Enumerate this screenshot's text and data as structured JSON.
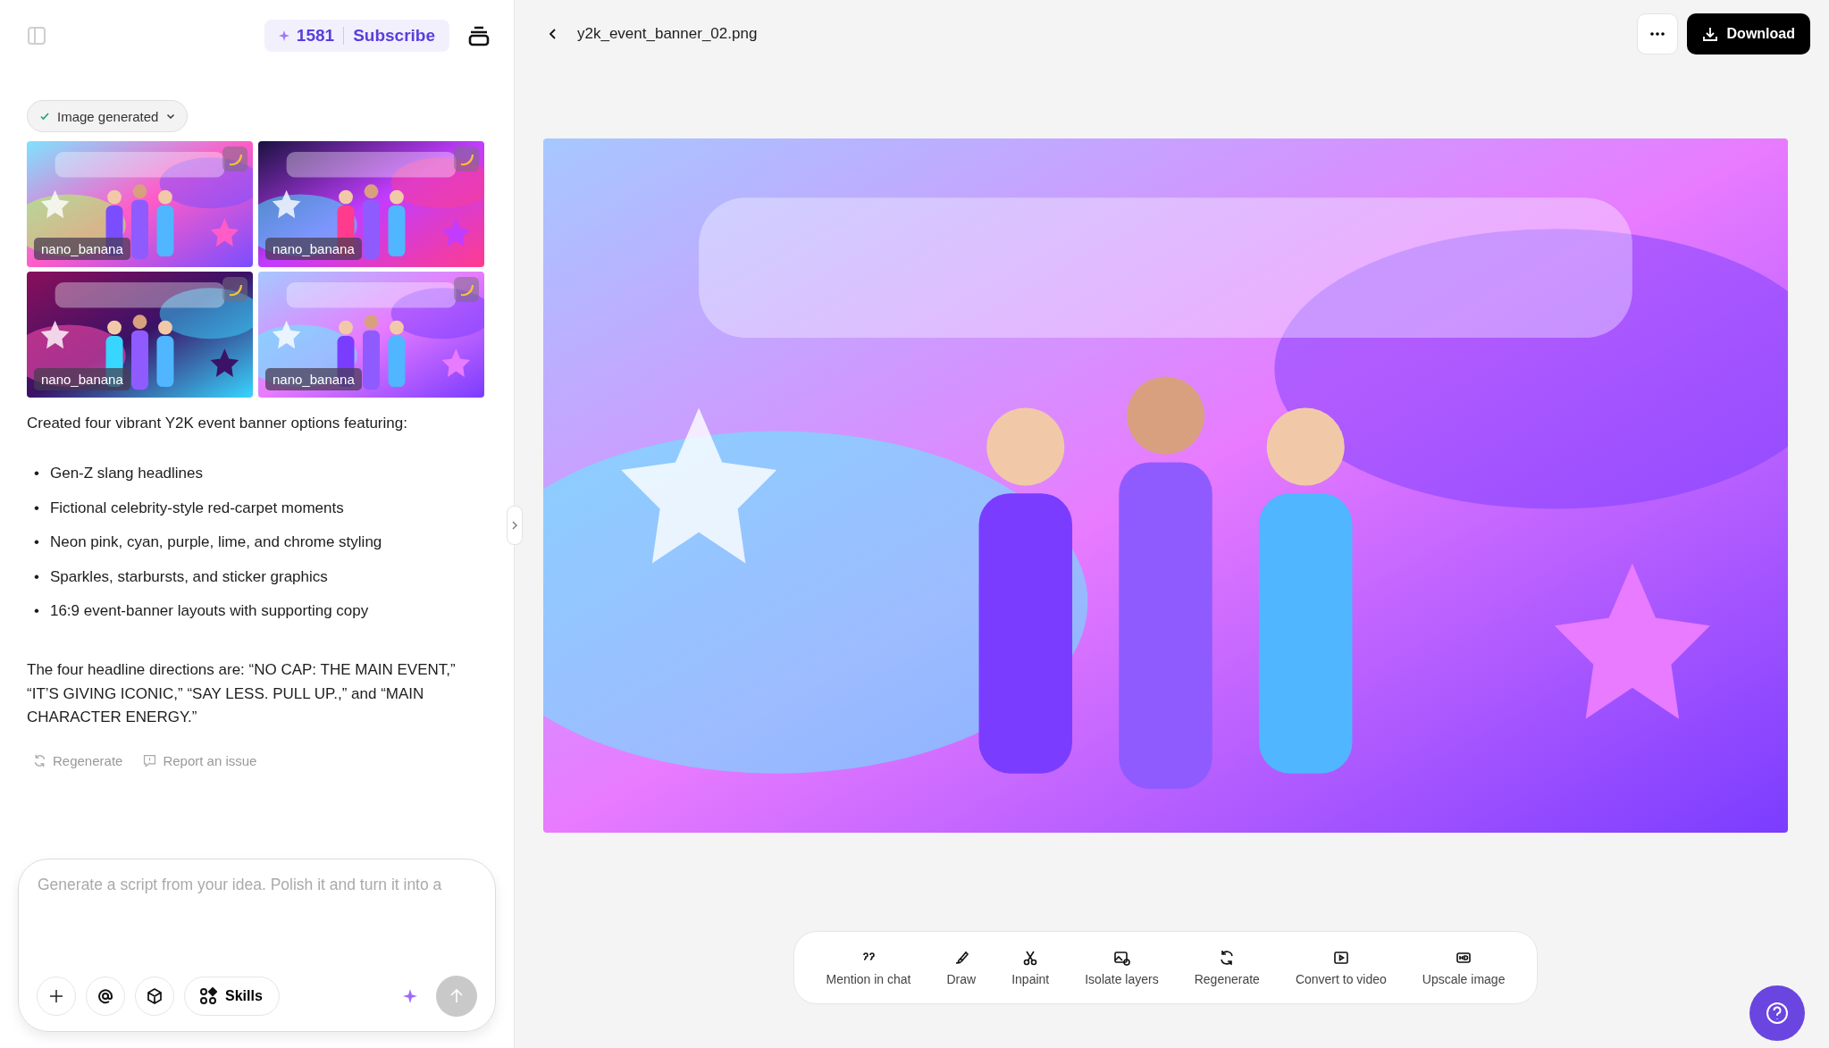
{
  "sidebar_header": {
    "credits": "1581",
    "subscribe": "Subscribe"
  },
  "chat": {
    "status": {
      "label": "Image generated",
      "done": true
    },
    "thumbnails": [
      {
        "kind": "picture",
        "model": "nano_banana"
      },
      {
        "kind": "picture",
        "model": "nano_banana"
      },
      {
        "kind": "picture",
        "model": "nano_banana"
      },
      {
        "kind": "picture",
        "model": "nano_banana"
      }
    ],
    "intro": "Created four vibrant Y2K event banner options featuring:",
    "bullets": [
      {
        "marker": "•",
        "text": "Gen-Z slang headlines"
      },
      {
        "marker": "•",
        "text": "Fictional celebrity-style red-carpet moments"
      },
      {
        "marker": "•",
        "text": "Neon pink, cyan, purple, lime, and chrome styling"
      },
      {
        "marker": "•",
        "text": "Sparkles, starbursts, and sticker graphics"
      },
      {
        "marker": "•",
        "text": "16:9 event-banner layouts with supporting copy"
      }
    ],
    "summary": "The four headline directions are: “NO CAP: THE MAIN EVENT,” “IT’S GIVING ICONIC,” “SAY LESS. PULL UP.,” and “MAIN CHARACTER ENERGY.”",
    "actions": [
      {
        "kind": "regenerate",
        "label": "Regenerate"
      },
      {
        "kind": "report",
        "label": "Report an issue"
      }
    ]
  },
  "composer": {
    "placeholder": "Generate a script from your idea. Polish it and turn it into a",
    "skills": "Skills"
  },
  "viewer": {
    "filename": "y2k_event_banner_02.png",
    "download": "Download"
  },
  "toolbar": [
    {
      "kind": "mention",
      "label": "Mention in chat"
    },
    {
      "kind": "draw",
      "label": "Draw"
    },
    {
      "kind": "inpaint",
      "label": "Inpaint"
    },
    {
      "kind": "isolate",
      "label": "Isolate layers"
    },
    {
      "kind": "regenerate",
      "label": "Regenerate"
    },
    {
      "kind": "video",
      "label": "Convert to video"
    },
    {
      "kind": "upscale",
      "label": "Upscale image"
    }
  ]
}
